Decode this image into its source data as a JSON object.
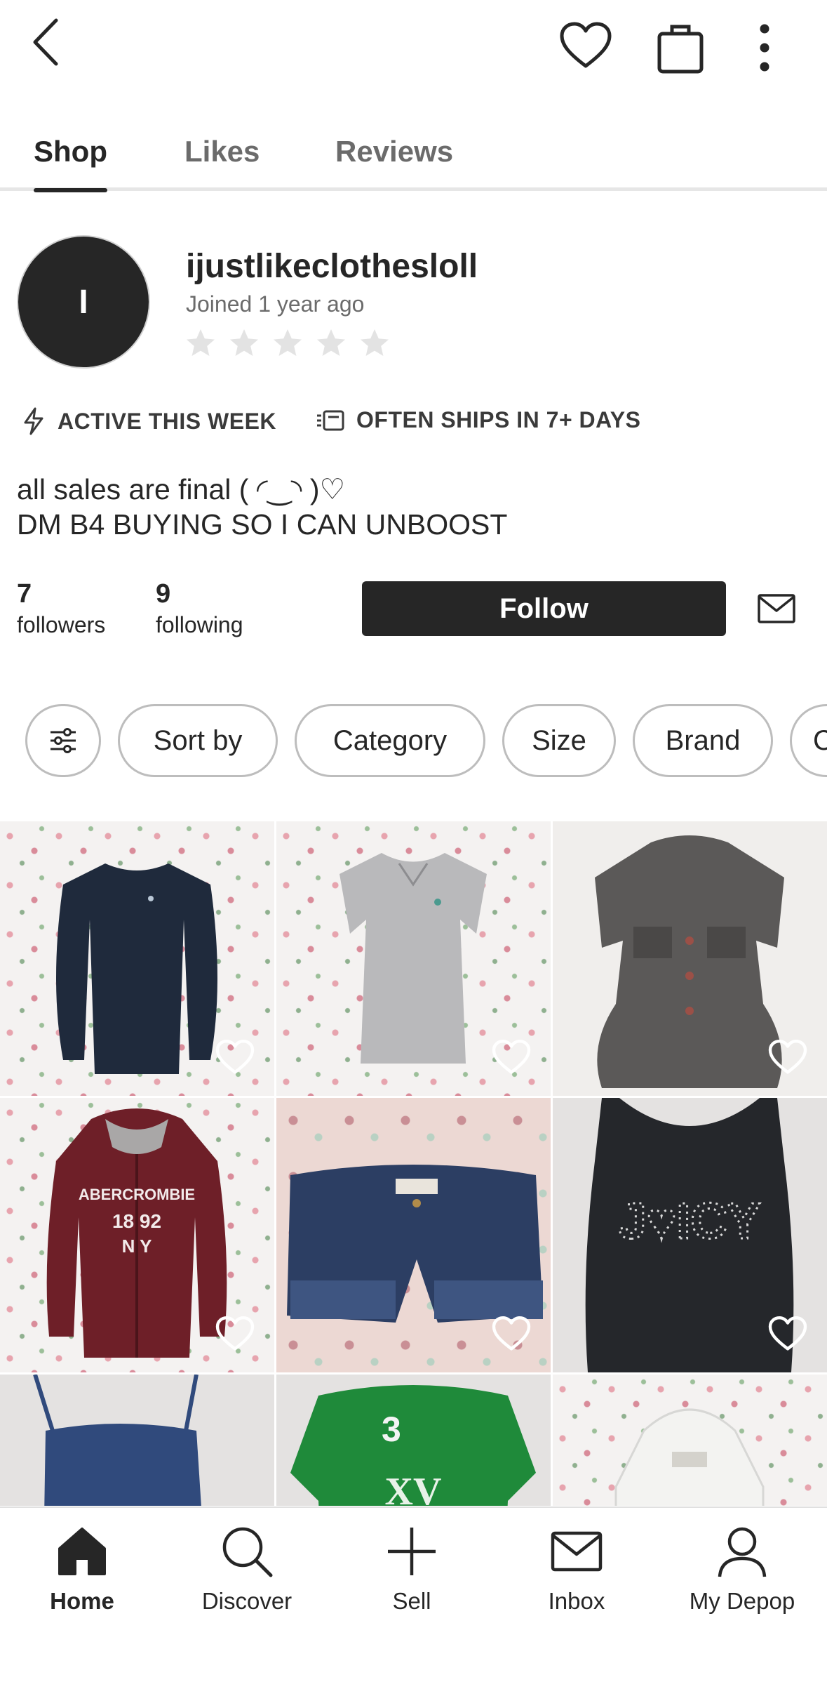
{
  "tabs": [
    {
      "label": "Shop",
      "active": true
    },
    {
      "label": "Likes",
      "active": false
    },
    {
      "label": "Reviews",
      "active": false
    }
  ],
  "profile": {
    "avatar_initial": "I",
    "username": "ijustlikeclothesloll",
    "joined": "Joined 1 year ago",
    "rating_stars": 0,
    "badges": {
      "active": "ACTIVE THIS WEEK",
      "ships": "OFTEN SHIPS IN 7+ DAYS"
    },
    "bio_line1": "all sales are final ( ◜‿◝ )♡",
    "bio_line2": "DM B4 BUYING SO I CAN UNBOOST",
    "followers_count": "7",
    "followers_label": "followers",
    "following_count": "9",
    "following_label": "following",
    "follow_label": "Follow"
  },
  "filters": {
    "sort": "Sort by",
    "category": "Category",
    "size": "Size",
    "brand": "Brand",
    "more": "Condition"
  },
  "products": [
    {
      "name": "navy-longsleeve-top",
      "bg": "floral",
      "color": "#1f2a3c"
    },
    {
      "name": "grey-tshirt",
      "bg": "floral",
      "color": "#b9b9bb"
    },
    {
      "name": "grey-ruffle-jacket",
      "bg": "concrete",
      "color": "#5b5958"
    },
    {
      "name": "maroon-zip-hoodie",
      "bg": "floral",
      "color": "#6e1f28"
    },
    {
      "name": "denim-shorts",
      "bg": "pink",
      "color": "#2c3e63"
    },
    {
      "name": "black-juicy-tank",
      "bg": "gray",
      "color": "#25272b"
    },
    {
      "name": "navy-cami",
      "bg": "gray",
      "color": "#304a7c"
    },
    {
      "name": "green-polo",
      "bg": "gray",
      "color": "#1f8a3a"
    },
    {
      "name": "white-hoodie",
      "bg": "floral",
      "color": "#f3f3f1"
    }
  ],
  "nav": {
    "home": "Home",
    "discover": "Discover",
    "sell": "Sell",
    "inbox": "Inbox",
    "my_depop": "My Depop"
  },
  "colors": {
    "primary": "#262626",
    "muted": "#6b6b6b",
    "divider": "#e6e6e6"
  }
}
